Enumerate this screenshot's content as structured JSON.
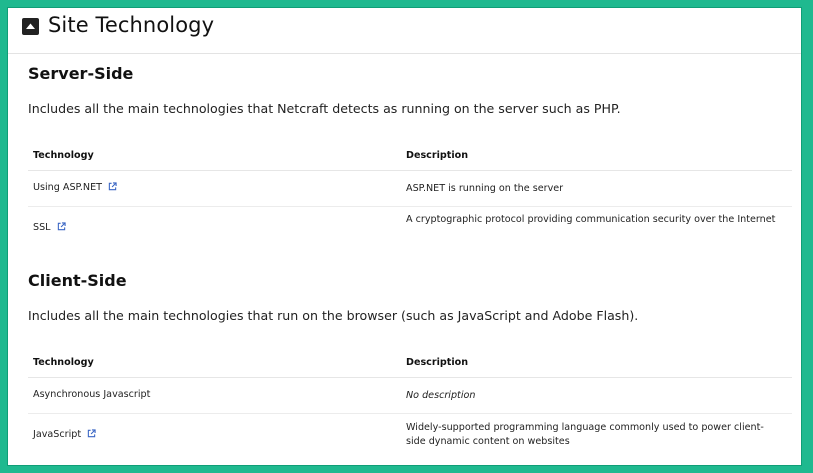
{
  "section": {
    "title": "Site Technology",
    "toggle_icon": "collapse-up-icon"
  },
  "server_side": {
    "heading": "Server-Side",
    "intro": "Includes all the main technologies that Netcraft detects as running on the server such as PHP.",
    "columns": {
      "technology": "Technology",
      "description": "Description"
    },
    "rows": [
      {
        "technology": "Using ASP.NET",
        "description": "ASP.NET is running on the server",
        "has_link": true,
        "italic": false
      },
      {
        "technology": "SSL",
        "description": "A cryptographic protocol providing communication security over the Internet",
        "has_link": true,
        "italic": false
      }
    ]
  },
  "client_side": {
    "heading": "Client-Side",
    "intro": "Includes all the main technologies that run on the browser (such as JavaScript and Adobe Flash).",
    "columns": {
      "technology": "Technology",
      "description": "Description"
    },
    "rows": [
      {
        "technology": "Asynchronous Javascript",
        "description": "No description",
        "has_link": false,
        "italic": true
      },
      {
        "technology": "JavaScript",
        "description": "Widely-supported programming language commonly used to power client-side dynamic content on websites",
        "has_link": true,
        "italic": false
      }
    ]
  },
  "colors": {
    "border_accent": "#1fb98f",
    "link_icon": "#3a66c4"
  }
}
